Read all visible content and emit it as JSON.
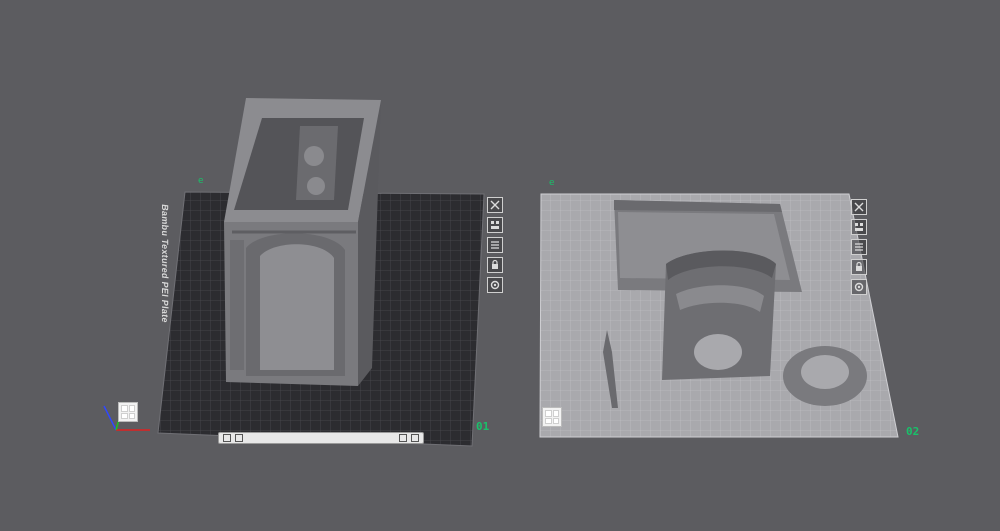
{
  "plates": [
    {
      "id": "01",
      "label": "Bambu Textured PEI Plate",
      "edit_marker": "e"
    },
    {
      "id": "02",
      "label": "",
      "edit_marker": "e"
    }
  ],
  "plate_tool_icons": [
    "close-icon",
    "auto-arrange-icon",
    "orient-icon",
    "lock-icon",
    "settings-icon"
  ],
  "bottom_toolbar": {
    "text": ""
  },
  "colors": {
    "background": "#5c5c60",
    "plate_dark": "#2c2c30",
    "plate_light": "#a9a9ad",
    "model_gray": "#7a7a7e",
    "accent_green": "#19c16a"
  }
}
